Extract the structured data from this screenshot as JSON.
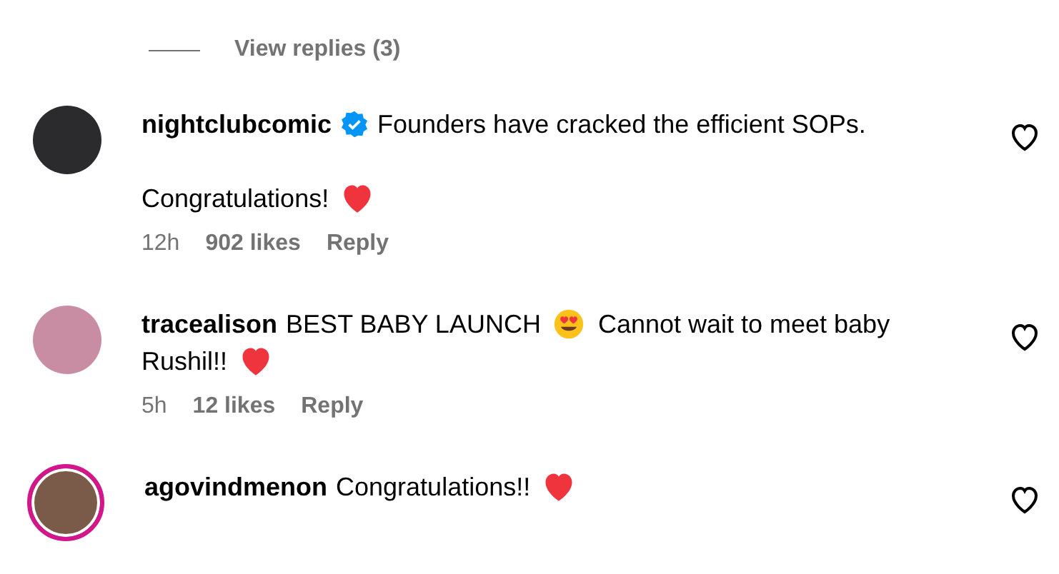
{
  "replies_link": {
    "label": "View replies (3)"
  },
  "comments": [
    {
      "username": "nightclubcomic",
      "verified": true,
      "story_ring": false,
      "liked": false,
      "paragraphs": [
        [
          [
            {
              "kind": "text",
              "text": "Founders have cracked the efficient SOPs."
            }
          ]
        ],
        [
          [
            {
              "kind": "text",
              "text": "Congratulations!"
            },
            {
              "kind": "heart"
            }
          ]
        ]
      ],
      "time": "12h",
      "likes": "902 likes",
      "reply": "Reply"
    },
    {
      "username": "tracealison",
      "verified": false,
      "story_ring": false,
      "liked": false,
      "paragraphs": [
        [
          [
            {
              "kind": "text",
              "text": "BEST BABY LAUNCH"
            },
            {
              "kind": "heart-eyes"
            },
            {
              "kind": "text",
              "text": "Cannot wait to meet baby"
            }
          ],
          [
            {
              "kind": "text",
              "text": "Rushil!!"
            },
            {
              "kind": "heart"
            }
          ]
        ]
      ],
      "time": "5h",
      "likes": "12 likes",
      "reply": "Reply"
    },
    {
      "username": "agovindmenon",
      "verified": false,
      "story_ring": true,
      "liked": false,
      "paragraphs": [
        [
          [
            {
              "kind": "text",
              "text": "Congratulations!!"
            },
            {
              "kind": "heart"
            }
          ]
        ]
      ]
    }
  ]
}
